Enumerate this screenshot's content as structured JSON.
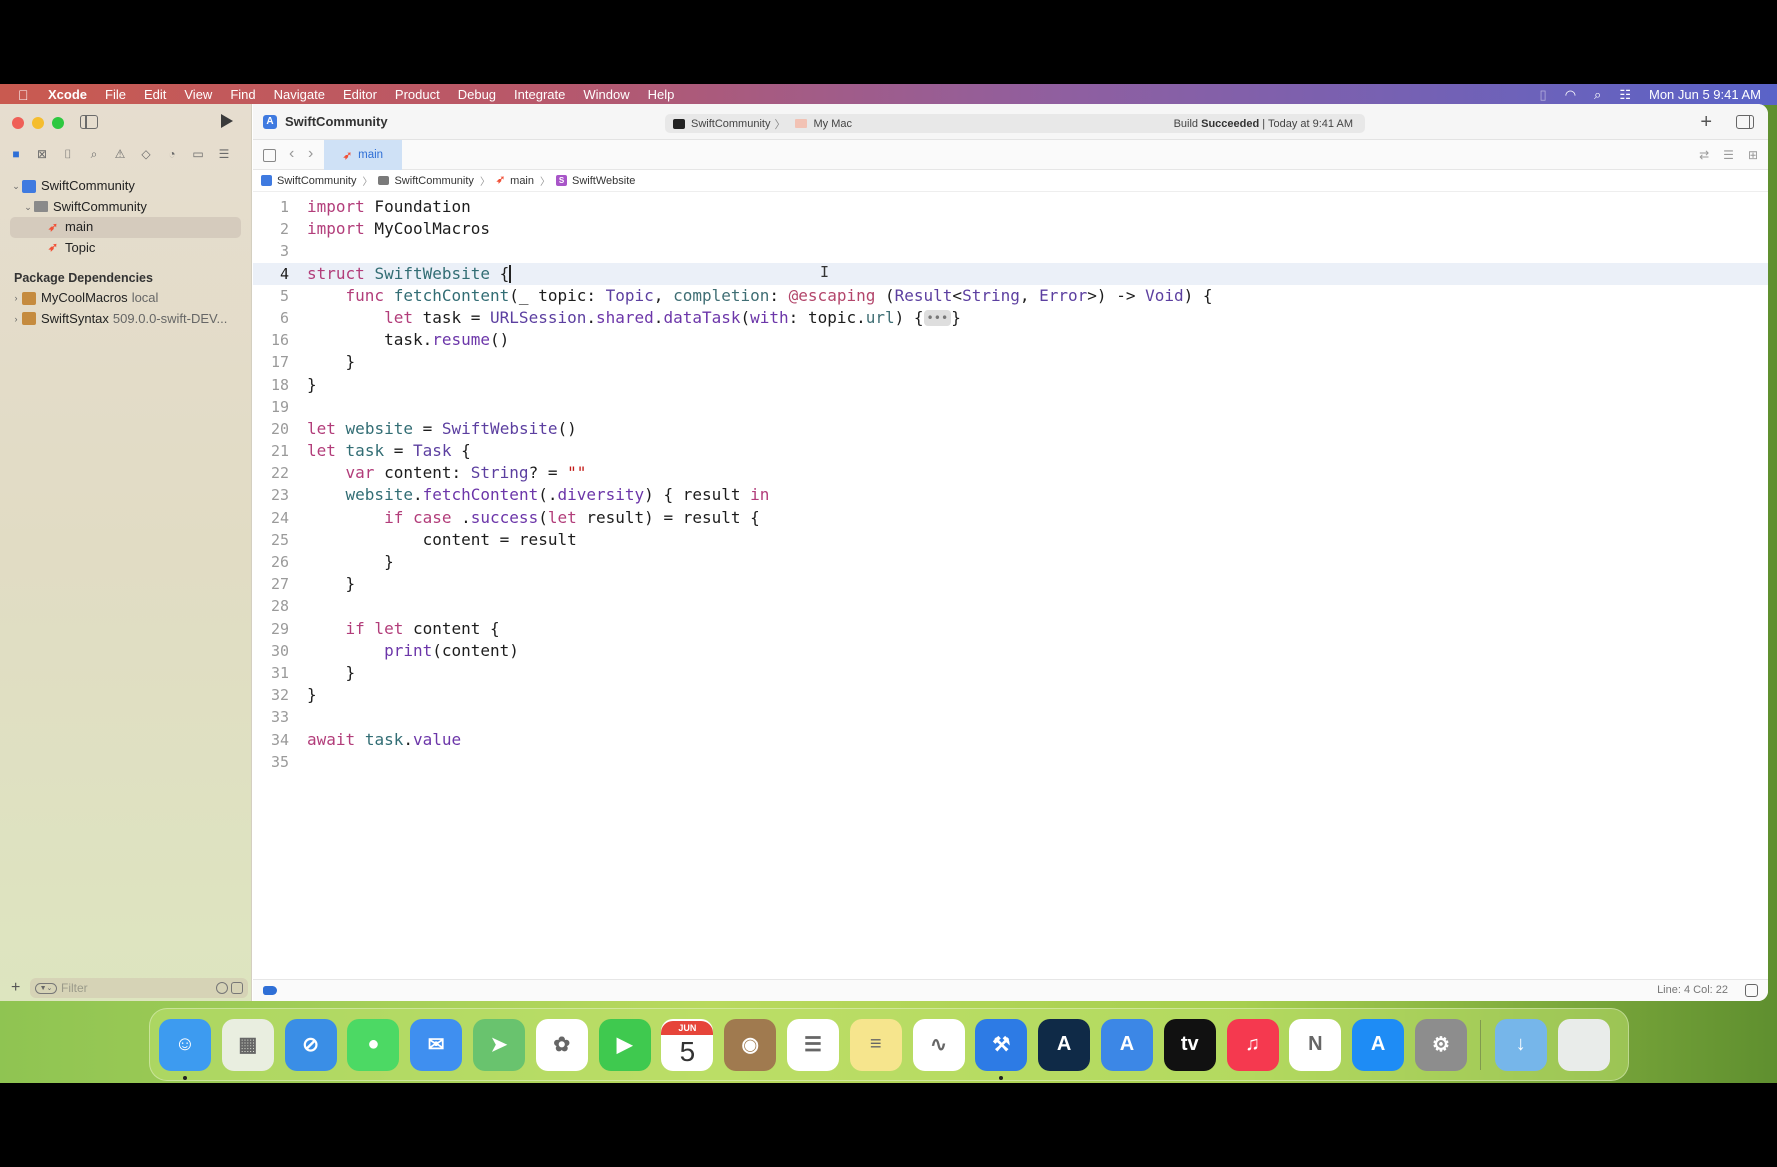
{
  "menubar": {
    "app": "Xcode",
    "items": [
      "File",
      "Edit",
      "View",
      "Find",
      "Navigate",
      "Editor",
      "Product",
      "Debug",
      "Integrate",
      "Window",
      "Help"
    ],
    "clock": "Mon Jun 5  9:41 AM"
  },
  "window": {
    "project_title": "SwiftCommunity",
    "activity": {
      "scheme": "SwiftCommunity",
      "destination": "My Mac",
      "status_prefix": "Build",
      "status_bold": "Succeeded",
      "status_suffix": " | Today at 9:41 AM"
    }
  },
  "navigator": {
    "tree": [
      {
        "label": "SwiftCommunity",
        "level": 0,
        "icon": "xcode-project-icon"
      },
      {
        "label": "SwiftCommunity",
        "level": 1,
        "icon": "folder-icon"
      },
      {
        "label": "main",
        "level": 2,
        "icon": "swift-file-icon",
        "selected": true
      },
      {
        "label": "Topic",
        "level": 2,
        "icon": "swift-file-icon"
      }
    ],
    "section_title": "Package Dependencies",
    "packages": [
      {
        "name": "MyCoolMacros",
        "detail": "local"
      },
      {
        "name": "SwiftSyntax",
        "detail": "509.0.0-swift-DEV..."
      }
    ],
    "filter_placeholder": "Filter"
  },
  "editor": {
    "tab": "main",
    "breadcrumb": [
      "SwiftCommunity",
      "SwiftCommunity",
      "main",
      "SwiftWebsite"
    ],
    "current_line": 4,
    "lines": [
      {
        "n": "1",
        "tokens": [
          [
            "kw",
            "import"
          ],
          [
            "",
            " Foundation"
          ]
        ]
      },
      {
        "n": "2",
        "tokens": [
          [
            "kw",
            "import"
          ],
          [
            "",
            " MyCoolMacros"
          ]
        ]
      },
      {
        "n": "3",
        "tokens": []
      },
      {
        "n": "4",
        "tokens": [
          [
            "kw",
            "struct"
          ],
          [
            "",
            " "
          ],
          [
            "fn",
            "SwiftWebsite"
          ],
          [
            "",
            " {"
          ],
          [
            "caret",
            ""
          ]
        ]
      },
      {
        "n": "5",
        "tokens": [
          [
            "",
            "    "
          ],
          [
            "kw",
            "func"
          ],
          [
            "",
            " "
          ],
          [
            "fn",
            "fetchContent"
          ],
          [
            "",
            "(_ topic: "
          ],
          [
            "ty",
            "Topic"
          ],
          [
            "",
            ", "
          ],
          [
            "pr",
            "completion"
          ],
          [
            "",
            ": "
          ],
          [
            "at",
            "@escaping"
          ],
          [
            "",
            " ("
          ],
          [
            "ty",
            "Result"
          ],
          [
            "",
            "<"
          ],
          [
            "ty",
            "String"
          ],
          [
            "",
            ", "
          ],
          [
            "ty",
            "Error"
          ],
          [
            "",
            ">) -> "
          ],
          [
            "ty",
            "Void"
          ],
          [
            "",
            ") {"
          ]
        ]
      },
      {
        "n": "6",
        "tokens": [
          [
            "",
            "        "
          ],
          [
            "kw",
            "let"
          ],
          [
            "",
            " task = "
          ],
          [
            "ty",
            "URLSession"
          ],
          [
            "",
            "."
          ],
          [
            "mt",
            "shared"
          ],
          [
            "",
            "."
          ],
          [
            "mt",
            "dataTask"
          ],
          [
            "",
            "("
          ],
          [
            "mt",
            "with"
          ],
          [
            "",
            ": topic."
          ],
          [
            "pr",
            "url"
          ],
          [
            "",
            ") {"
          ],
          [
            "fold",
            "•••"
          ],
          [
            "",
            "}"
          ]
        ]
      },
      {
        "n": "16",
        "tokens": [
          [
            "",
            "        task."
          ],
          [
            "mt",
            "resume"
          ],
          [
            "",
            "()"
          ]
        ]
      },
      {
        "n": "17",
        "tokens": [
          [
            "",
            "    }"
          ]
        ]
      },
      {
        "n": "18",
        "tokens": [
          [
            "",
            "}"
          ]
        ]
      },
      {
        "n": "19",
        "tokens": []
      },
      {
        "n": "20",
        "tokens": [
          [
            "kw",
            "let"
          ],
          [
            "",
            " "
          ],
          [
            "fn",
            "website"
          ],
          [
            "",
            " = "
          ],
          [
            "ty",
            "SwiftWebsite"
          ],
          [
            "",
            "()"
          ]
        ]
      },
      {
        "n": "21",
        "tokens": [
          [
            "kw",
            "let"
          ],
          [
            "",
            " "
          ],
          [
            "fn",
            "task"
          ],
          [
            "",
            " = "
          ],
          [
            "ty",
            "Task"
          ],
          [
            "",
            " {"
          ]
        ]
      },
      {
        "n": "22",
        "tokens": [
          [
            "",
            "    "
          ],
          [
            "kw",
            "var"
          ],
          [
            "",
            " content: "
          ],
          [
            "ty",
            "String"
          ],
          [
            "",
            "? = "
          ],
          [
            "str",
            "\"\""
          ]
        ]
      },
      {
        "n": "23",
        "tokens": [
          [
            "",
            "    "
          ],
          [
            "fn",
            "website"
          ],
          [
            "",
            "."
          ],
          [
            "mt",
            "fetchContent"
          ],
          [
            "",
            "(."
          ],
          [
            "mt",
            "diversity"
          ],
          [
            "",
            ") { result "
          ],
          [
            "kw",
            "in"
          ]
        ]
      },
      {
        "n": "24",
        "tokens": [
          [
            "",
            "        "
          ],
          [
            "kw",
            "if case"
          ],
          [
            "",
            " ."
          ],
          [
            "mt",
            "success"
          ],
          [
            "",
            "("
          ],
          [
            "kw",
            "let"
          ],
          [
            "",
            " result) = result {"
          ]
        ]
      },
      {
        "n": "25",
        "tokens": [
          [
            "",
            "            content = result"
          ]
        ]
      },
      {
        "n": "26",
        "tokens": [
          [
            "",
            "        }"
          ]
        ]
      },
      {
        "n": "27",
        "tokens": [
          [
            "",
            "    }"
          ]
        ]
      },
      {
        "n": "28",
        "tokens": []
      },
      {
        "n": "29",
        "tokens": [
          [
            "",
            "    "
          ],
          [
            "kw",
            "if let"
          ],
          [
            "",
            " content {"
          ]
        ]
      },
      {
        "n": "30",
        "tokens": [
          [
            "",
            "        "
          ],
          [
            "mt",
            "print"
          ],
          [
            "",
            "(content)"
          ]
        ]
      },
      {
        "n": "31",
        "tokens": [
          [
            "",
            "    }"
          ]
        ]
      },
      {
        "n": "32",
        "tokens": [
          [
            "",
            "}"
          ]
        ]
      },
      {
        "n": "33",
        "tokens": []
      },
      {
        "n": "34",
        "tokens": [
          [
            "kw",
            "await"
          ],
          [
            "",
            " "
          ],
          [
            "fn",
            "task"
          ],
          [
            "",
            "."
          ],
          [
            "mt",
            "value"
          ]
        ]
      },
      {
        "n": "35",
        "tokens": []
      }
    ]
  },
  "statusbar": {
    "position": "Line: 4  Col: 22"
  },
  "dock": {
    "apps": [
      {
        "name": "Finder",
        "color": "#3d9bf0",
        "glyph": "☺",
        "running": true
      },
      {
        "name": "Launchpad",
        "color": "#e9eee0",
        "glyph": "▦"
      },
      {
        "name": "Safari",
        "color": "#3a8ee6",
        "glyph": "⊘"
      },
      {
        "name": "Messages",
        "color": "#4cd964",
        "glyph": "●"
      },
      {
        "name": "Mail",
        "color": "#3f8ff0",
        "glyph": "✉"
      },
      {
        "name": "Maps",
        "color": "#69c36e",
        "glyph": "➤"
      },
      {
        "name": "Photos",
        "color": "#ffffff",
        "glyph": "✿"
      },
      {
        "name": "FaceTime",
        "color": "#3fc94f",
        "glyph": "▶"
      },
      {
        "name": "Calendar",
        "color": "#ffffff",
        "month": "JUN",
        "day": "5"
      },
      {
        "name": "Contacts",
        "color": "#a07a4f",
        "glyph": "◉"
      },
      {
        "name": "Reminders",
        "color": "#ffffff",
        "glyph": "☰"
      },
      {
        "name": "Notes",
        "color": "#f6e58d",
        "glyph": "≡"
      },
      {
        "name": "Freeform",
        "color": "#ffffff",
        "glyph": "∿"
      },
      {
        "name": "Xcode",
        "color": "#2d7be5",
        "glyph": "⚒",
        "running": true
      },
      {
        "name": "Instruments",
        "color": "#0f2a47",
        "glyph": "A"
      },
      {
        "name": "Simulator",
        "color": "#3c87e6",
        "glyph": "A"
      },
      {
        "name": "Apple TV",
        "color": "#111111",
        "glyph": "tv"
      },
      {
        "name": "Music",
        "color": "#f5394f",
        "glyph": "♫"
      },
      {
        "name": "News",
        "color": "#ffffff",
        "glyph": "N"
      },
      {
        "name": "App Store",
        "color": "#1e8cf5",
        "glyph": "A"
      },
      {
        "name": "System Settings",
        "color": "#8d8d8d",
        "glyph": "⚙"
      }
    ],
    "stack": [
      {
        "name": "Downloads",
        "color": "#76b6ea",
        "glyph": "↓"
      },
      {
        "name": "Trash",
        "color": "#e9ecea",
        "glyph": ""
      }
    ]
  }
}
